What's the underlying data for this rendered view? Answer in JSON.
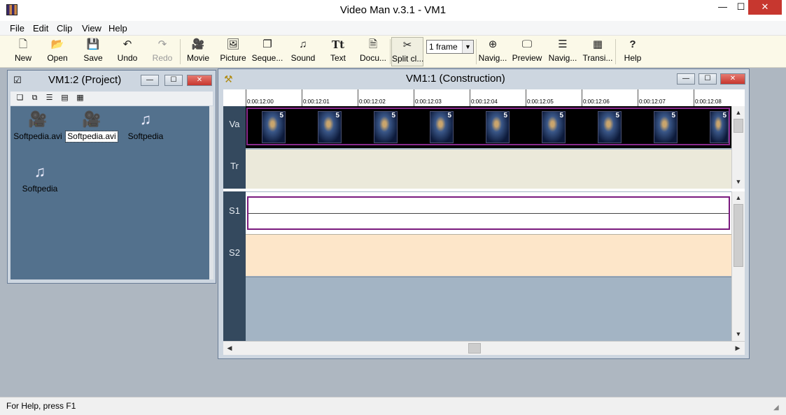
{
  "window": {
    "title": "Video Man v.3.1 - VM1",
    "controls": {
      "minimize": "—",
      "maximize": "☐",
      "close": "✕"
    }
  },
  "menu": {
    "items": [
      "File",
      "Edit",
      "Clip",
      "View",
      "Help"
    ]
  },
  "toolbar": {
    "items": [
      {
        "label": "New",
        "icon": "new-file-icon",
        "glyph": "🗋"
      },
      {
        "label": "Open",
        "icon": "open-folder-icon",
        "glyph": "📂"
      },
      {
        "label": "Save",
        "icon": "save-disk-icon",
        "glyph": "💾"
      },
      {
        "label": "Undo",
        "icon": "undo-icon",
        "glyph": "↶"
      },
      {
        "label": "Redo",
        "icon": "redo-icon",
        "glyph": "↷",
        "disabled": true
      },
      {
        "label": "Movie",
        "icon": "movie-camera-icon",
        "glyph": "🎥"
      },
      {
        "label": "Picture",
        "icon": "picture-icon",
        "glyph": "🖼"
      },
      {
        "label": "Seque...",
        "icon": "sequence-icon",
        "glyph": "❐"
      },
      {
        "label": "Sound",
        "icon": "music-note-icon",
        "glyph": "♫"
      },
      {
        "label": "Text",
        "icon": "text-icon",
        "glyph": "Tt"
      },
      {
        "label": "Docu...",
        "icon": "document-icon",
        "glyph": "🗎"
      },
      {
        "label": "Split cl...",
        "icon": "scissors-icon",
        "glyph": "✂",
        "pressed": true
      },
      {
        "label": "Navig...",
        "icon": "crosshair-icon",
        "glyph": "⊕"
      },
      {
        "label": "Preview",
        "icon": "monitor-icon",
        "glyph": "🖵"
      },
      {
        "label": "Navig...",
        "icon": "list-icon",
        "glyph": "☰"
      },
      {
        "label": "Transi...",
        "icon": "transition-grid-icon",
        "glyph": "▦"
      },
      {
        "label": "Help",
        "icon": "help-icon",
        "glyph": "?"
      }
    ],
    "frame_select": "1 frame"
  },
  "project_window": {
    "title": "VM1:2 (Project)",
    "items": [
      {
        "label": "Softpedia.avi",
        "icon": "video-camera-icon",
        "glyph": "🎥"
      },
      {
        "label": "Softpedia.avi",
        "icon": "video-camera-icon",
        "glyph": "🎥",
        "selected": true
      },
      {
        "label": "Softpedia",
        "icon": "music-note-icon",
        "glyph": "♫"
      },
      {
        "label": "Softpedia",
        "icon": "music-note-icon",
        "glyph": "♫"
      }
    ]
  },
  "construction_window": {
    "title": "VM1:1 (Construction)",
    "timecodes": [
      "0:00:12:00",
      "0:00:12:01",
      "0:00:12:02",
      "0:00:12:03",
      "0:00:12:04",
      "0:00:12:05",
      "0:00:12:06",
      "0:00:12:07",
      "0:00:12:08"
    ],
    "tracks": {
      "va": "Va",
      "tr": "Tr",
      "s1": "S1",
      "s2": "S2"
    },
    "frame_label": "5"
  },
  "status": {
    "text": "For Help, press F1"
  }
}
